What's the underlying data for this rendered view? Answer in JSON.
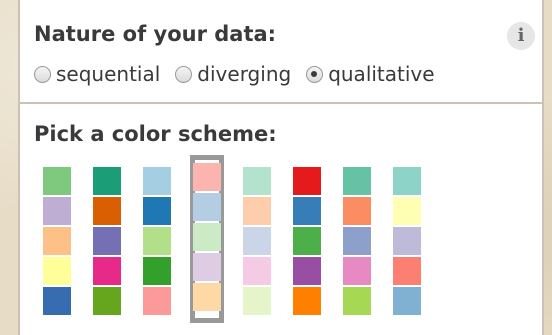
{
  "nature": {
    "title": "Nature of your data:",
    "info_icon_glyph": "i",
    "options": [
      {
        "label": "sequential",
        "checked": false
      },
      {
        "label": "diverging",
        "checked": false
      },
      {
        "label": "qualitative",
        "checked": true
      }
    ]
  },
  "scheme": {
    "title": "Pick a color scheme:",
    "selected_index": 3,
    "schemes": [
      [
        "#7fc97f",
        "#beaed4",
        "#fdc086",
        "#ffff99",
        "#386cb0"
      ],
      [
        "#1b9e77",
        "#d95f02",
        "#7570b3",
        "#e7298a",
        "#66a61e"
      ],
      [
        "#a6cee3",
        "#1f78b4",
        "#b2df8a",
        "#33a02c",
        "#fb9a99"
      ],
      [
        "#fbb4ae",
        "#b3cde3",
        "#ccebc5",
        "#decbe4",
        "#fed9a6"
      ],
      [
        "#b3e2cd",
        "#fdcdac",
        "#cbd5e8",
        "#f4cae4",
        "#e6f5c9"
      ],
      [
        "#e41a1c",
        "#377eb8",
        "#4daf4a",
        "#984ea3",
        "#ff7f00"
      ],
      [
        "#66c2a5",
        "#fc8d62",
        "#8da0cb",
        "#e78ac3",
        "#a6d854"
      ],
      [
        "#8dd3c7",
        "#ffffb3",
        "#bebada",
        "#fb8072",
        "#80b1d3"
      ]
    ]
  }
}
